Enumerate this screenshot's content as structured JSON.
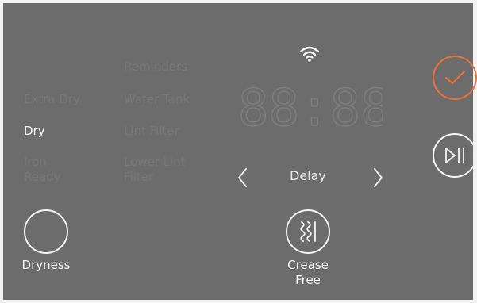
{
  "panel": {
    "status_left": {
      "extra_dry": "Extra Dry",
      "dry": "Dry",
      "iron_ready": "Iron\nReady"
    },
    "status_right": {
      "reminders": "Reminders",
      "water_tank": "Water Tank",
      "lint_filter": "Lint Filter",
      "lower_lint_filter": "Lower Lint\nFilter"
    },
    "display": {
      "time": "88:88",
      "delay_label": "Delay"
    },
    "buttons": {
      "dryness_label": "Dryness",
      "crease_free_label": "Crease\nFree"
    },
    "colors": {
      "panel": "#6c6c6c",
      "accent_orange": "#e5733a",
      "active_text": "#f5f5f5",
      "inactive_text": "#777777"
    },
    "icons": {
      "wifi": "wifi-icon",
      "confirm": "checkmark-icon",
      "start_pause": "play-pause-icon",
      "crease": "crease-free-icon",
      "prev": "chevron-left-icon",
      "next": "chevron-right-icon"
    }
  }
}
